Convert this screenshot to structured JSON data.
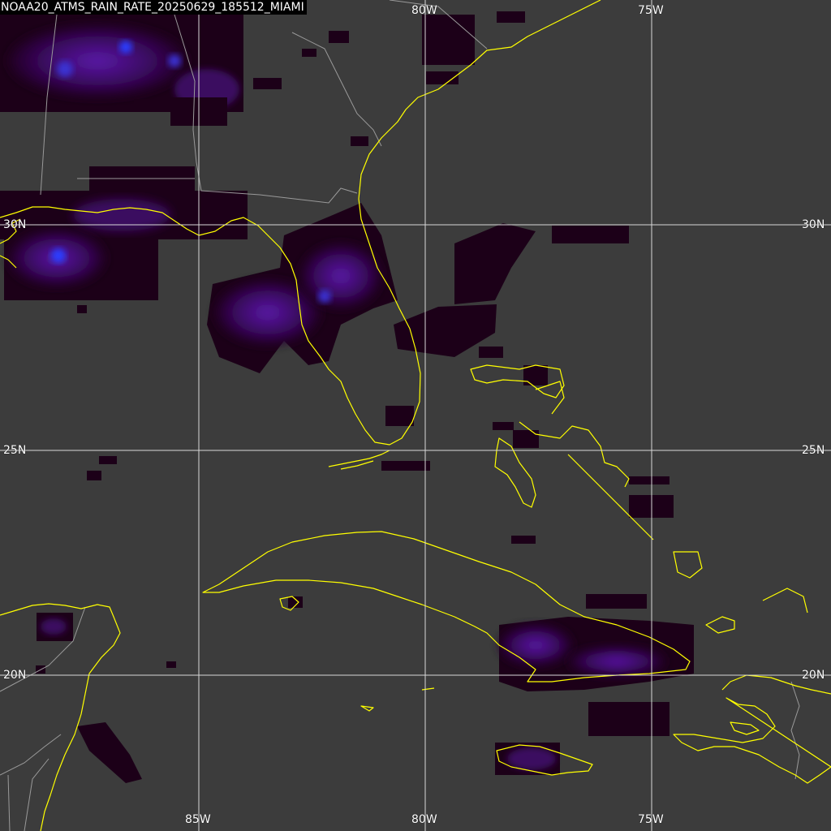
{
  "title": "NOAA20_ATMS_RAIN_RATE_20250629_185512_MIAMI",
  "grid": {
    "lon_top": [
      "80W",
      "75W"
    ],
    "lon_bottom": [
      "85W",
      "80W",
      "75W"
    ],
    "lat_left": [
      "30N",
      "25N",
      "20N"
    ],
    "lat_right": [
      "30N",
      "25N",
      "20N"
    ]
  },
  "colors": {
    "background": "#3c3c3c",
    "gridline": "#d8d8d8",
    "coastline": "#ffff00",
    "border": "#9a9a9a",
    "rain_light": "#1a0018",
    "rain_moderate": "#4a0a7a",
    "rain_heavy": "#2a3cff"
  }
}
